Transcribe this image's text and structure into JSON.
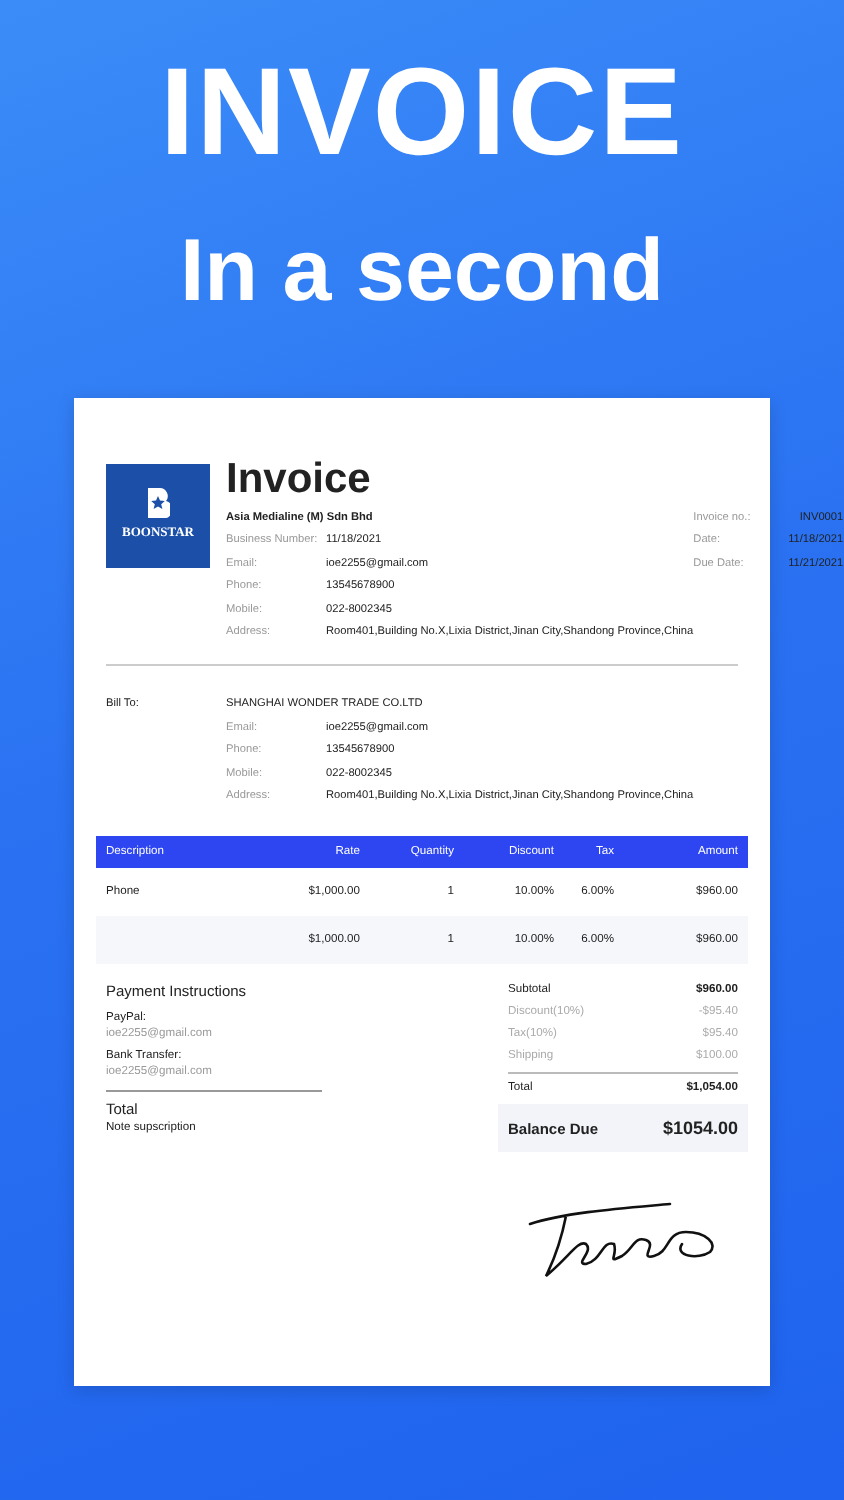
{
  "headline": "INVOICE",
  "subheadline": "In a second",
  "invoice": {
    "logo": {
      "name": "BOONSTAR"
    },
    "title": "Invoice",
    "company": "Asia Medialine (M) Sdn Bhd",
    "sender_fields": [
      {
        "label": "Business Number:",
        "value": "11/18/2021"
      },
      {
        "label": "Email:",
        "value": "ioe2255@gmail.com"
      },
      {
        "label": "Phone:",
        "value": "13545678900"
      },
      {
        "label": "Mobile:",
        "value": "022-8002345"
      },
      {
        "label": "Address:",
        "value": "Room401,Building No.X,Lixia District,Jinan City,Shandong Province,China"
      }
    ],
    "meta_fields": [
      {
        "label": "Invoice no.:",
        "value": "INV0001"
      },
      {
        "label": "Date:",
        "value": "11/18/2021"
      },
      {
        "label": "Due Date:",
        "value": "11/21/2021"
      }
    ],
    "bill_to": {
      "label": "Bill To:",
      "name": "SHANGHAI WONDER TRADE CO.LTD",
      "fields": [
        {
          "label": "Email:",
          "value": "ioe2255@gmail.com"
        },
        {
          "label": "Phone:",
          "value": "13545678900"
        },
        {
          "label": "Mobile:",
          "value": "022-8002345"
        },
        {
          "label": "Address:",
          "value": "Room401,Building No.X,Lixia District,Jinan City,Shandong Province,China"
        }
      ]
    },
    "table": {
      "columns": [
        "Description",
        "Rate",
        "Quantity",
        "Discount",
        "Tax",
        "Amount"
      ],
      "rows": [
        [
          "Phone",
          "$1,000.00",
          "1",
          "10.00%",
          "6.00%",
          "$960.00"
        ],
        [
          "",
          "$1,000.00",
          "1",
          "10.00%",
          "6.00%",
          "$960.00"
        ]
      ]
    },
    "payment": {
      "title": "Payment Instructions",
      "methods": [
        {
          "label": "PayPal:",
          "value": "ioe2255@gmail.com"
        },
        {
          "label": "Bank Transfer:",
          "value": "ioe2255@gmail.com"
        }
      ]
    },
    "note": {
      "title": "Total",
      "text": "Note supscription"
    },
    "totals": [
      {
        "label": "Subtotal",
        "value": "$960.00",
        "kind": "main"
      },
      {
        "label": "Discount(10%)",
        "value": "-$95.40",
        "kind": "minor"
      },
      {
        "label": "Tax(10%)",
        "value": "$95.40",
        "kind": "minor"
      },
      {
        "label": "Shipping",
        "value": "$100.00",
        "kind": "minor"
      },
      {
        "label": "Total",
        "value": "$1,054.00",
        "kind": "main"
      }
    ],
    "balance_due": {
      "label": "Balance Due",
      "value": "$1054.00"
    }
  }
}
